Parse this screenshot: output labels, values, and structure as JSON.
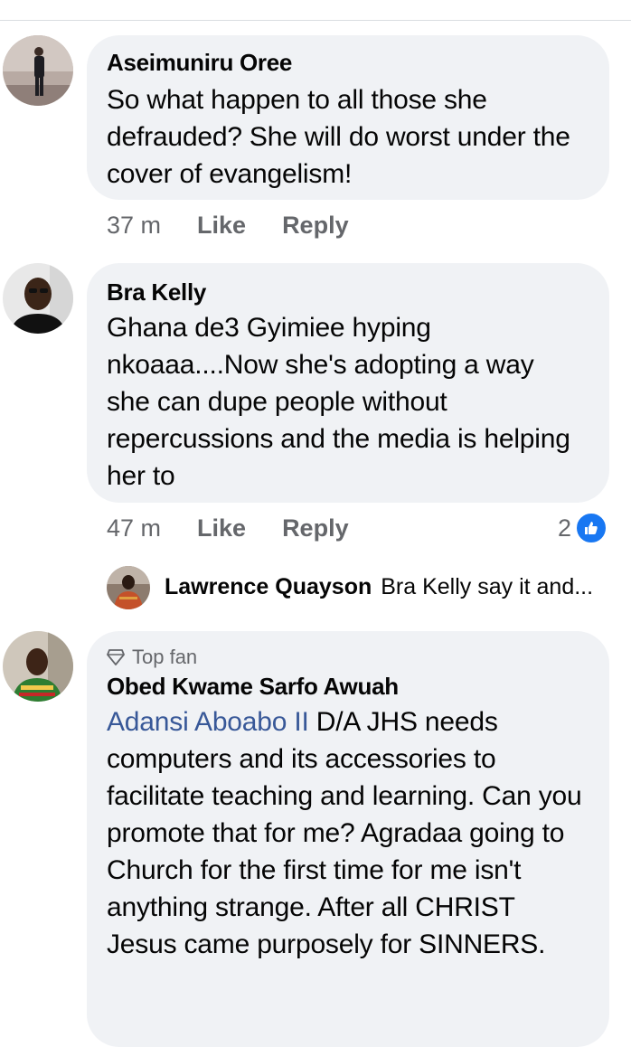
{
  "comments": [
    {
      "author": "Aseimuniru Oree",
      "text": "So what happen to all those she defrauded? She will do worst under the cover of evangelism!",
      "time": "37 m",
      "like_label": "Like",
      "reply_label": "Reply"
    },
    {
      "author": "Bra Kelly",
      "text": "Ghana de3 Gyimiee hyping nkoaaa....Now she's  adopting a way she can dupe people without repercussions and the media is helping her to",
      "time": "47 m",
      "like_label": "Like",
      "reply_label": "Reply",
      "reaction_count": "2",
      "reply_preview": {
        "author": "Lawrence Quayson",
        "text": "Bra Kelly say it and..."
      }
    },
    {
      "badge": "Top fan",
      "author": "Obed Kwame Sarfo Awuah",
      "mention": "Adansi Aboabo II",
      "text": " D/A JHS needs computers and its accessories to facilitate teaching and learning. Can you promote that for me? Agradaa going to Church for the first time for me isn't anything strange. After all CHRIST Jesus came purposely for SINNERS."
    }
  ],
  "colors": {
    "bubble": "#f0f2f5",
    "link": "#385898",
    "meta": "#65676b",
    "like_reaction": "#1877f2"
  },
  "icons": {
    "reaction": "like-thumb-icon",
    "badge": "diamond-icon"
  }
}
